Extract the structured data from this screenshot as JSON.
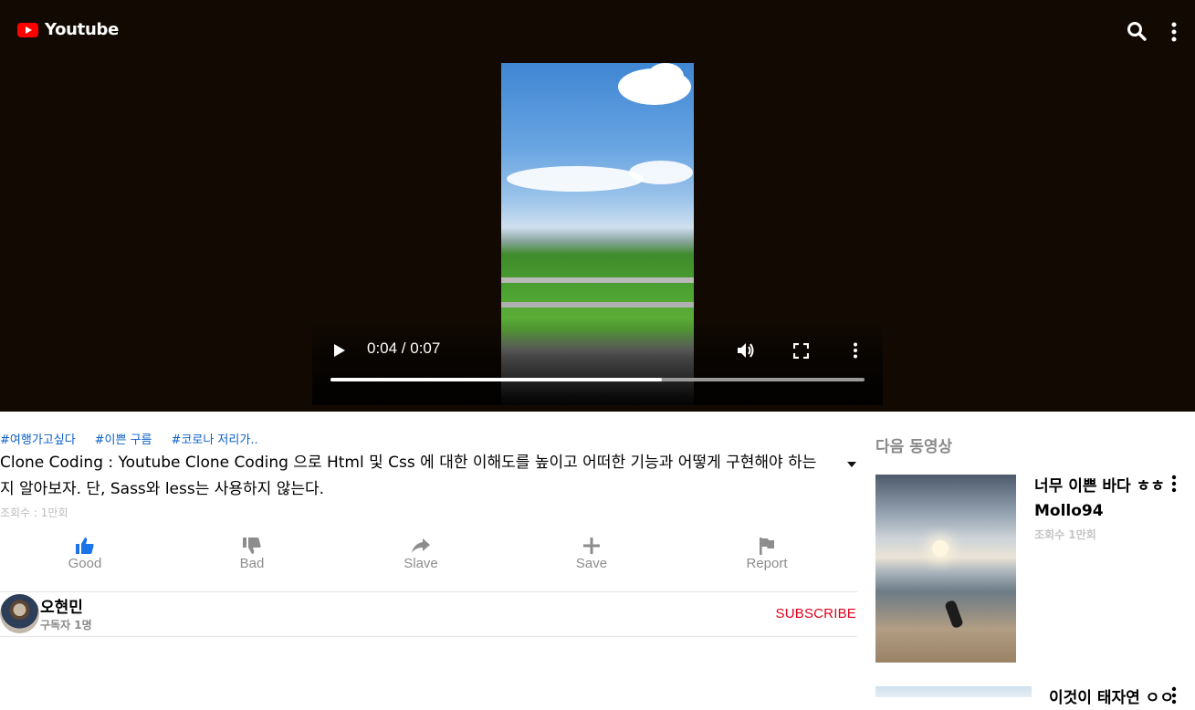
{
  "header": {
    "logo_text": "Youtube",
    "icons": [
      "youtube-logo-icon",
      "search-icon",
      "more-vertical-icon"
    ]
  },
  "player": {
    "current_time": "0:04",
    "duration": "0:07",
    "time_label": "0:04 / 0:07",
    "progress_fraction": 0.62,
    "icons": [
      "play-icon",
      "volume-icon",
      "fullscreen-icon",
      "more-vertical-icon"
    ]
  },
  "video": {
    "hashtags": [
      "#여행가고싶다",
      "#이쁜 구름",
      "#코로나 저리가.."
    ],
    "title": "Clone Coding : Youtube Clone Coding 으로 Html 및 Css 에 대한 이해도를 높이고 어떠한 기능과 어떻게 구현해야 하는지 알아보자. 단, Sass와 less는 사용하지 않는다.",
    "views": "조회수 : 1만회"
  },
  "actions": [
    {
      "label": "Good",
      "icon": "thumbs-up-icon",
      "color": "#1a73e8"
    },
    {
      "label": "Bad",
      "icon": "thumbs-down-icon",
      "color": "#8d8d8d"
    },
    {
      "label": "Slave",
      "icon": "share-icon",
      "color": "#8d8d8d"
    },
    {
      "label": "Save",
      "icon": "plus-icon",
      "color": "#8d8d8d"
    },
    {
      "label": "Report",
      "icon": "flag-icon",
      "color": "#8d8d8d"
    }
  ],
  "channel": {
    "name": "오현민",
    "subscribers": "구독자 1명",
    "subscribe_label": "SUBSCRIBE"
  },
  "sidebar": {
    "heading": "다음 동영상",
    "items": [
      {
        "title": "너무 이쁜 바다 ㅎㅎ",
        "channel": "Mollo94",
        "views": "조회수 1만회"
      },
      {
        "title": "이것이 태자연 ㅇㅇ",
        "channel": "",
        "views": ""
      }
    ]
  },
  "colors": {
    "header_bg": "#120a02",
    "accent_red": "#ff0000",
    "subscribe_red": "#e0001a",
    "hashtag_blue": "#0b5fc7"
  }
}
